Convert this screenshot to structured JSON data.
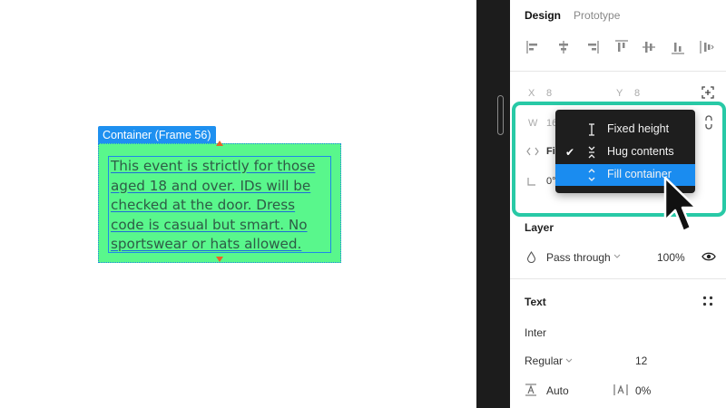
{
  "canvas": {
    "frame_label": "Container (Frame 56)",
    "text_lines": [
      "This event is strictly for those",
      "aged 18 and over. IDs will be",
      "checked at the door. Dress",
      "code is casual but smart. No",
      "sportswear or hats allowed."
    ],
    "frame_fill": "#59f78c",
    "selection_color": "#1e90f0"
  },
  "panel": {
    "tabs": {
      "design": "Design",
      "prototype": "Prototype"
    },
    "align_icons": [
      "align-left-icon",
      "align-horizontal-center-icon",
      "align-right-icon",
      "align-top-icon",
      "align-vertical-center-icon",
      "align-bottom-icon",
      "distribute-icon"
    ],
    "position": {
      "x_label": "X",
      "x_value": "8",
      "y_label": "Y",
      "y_value": "8"
    },
    "size": {
      "w_label": "W",
      "w_value": "16",
      "resize_label": "Fi",
      "rotation_value": "0°"
    },
    "dropdown": {
      "items": [
        {
          "label": "Fixed height",
          "checked": false,
          "selected": false
        },
        {
          "label": "Hug contents",
          "checked": true,
          "selected": false
        },
        {
          "label": "Fill container",
          "checked": false,
          "selected": true
        }
      ]
    },
    "layer": {
      "title": "Layer",
      "blend_mode": "Pass through",
      "opacity": "100%"
    },
    "text": {
      "title": "Text",
      "font_family": "Inter",
      "font_weight": "Regular",
      "font_size": "12",
      "line_height": "Auto",
      "letter_spacing": "0%"
    },
    "highlight_color": "#28c9a6"
  }
}
